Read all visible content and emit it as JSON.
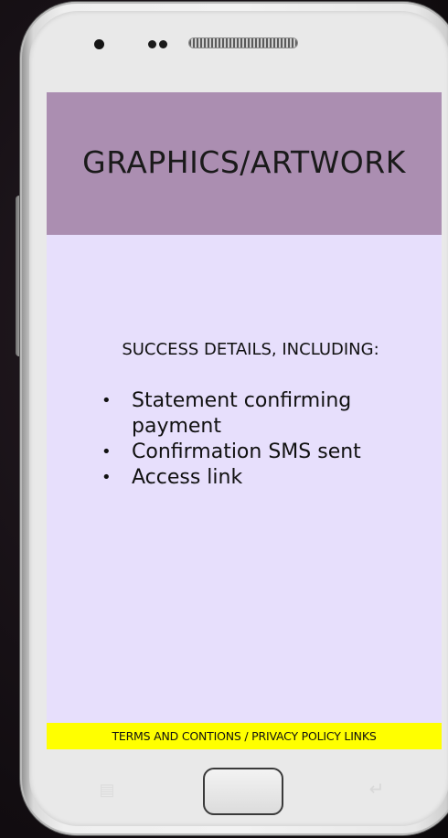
{
  "screen": {
    "header": {
      "title": "GRAPHICS/ARTWORK",
      "background_color": "#ab8eb1"
    },
    "body": {
      "background_color": "#e7dffc",
      "heading": "SUCCESS DETAILS, INCLUDING:",
      "items": [
        "Statement confirming payment",
        "Confirmation SMS sent",
        "Access link"
      ]
    },
    "footer": {
      "label": "TERMS AND CONTIONS / PRIVACY POLICY LINKS",
      "background_color": "#ffff00"
    }
  },
  "device": {
    "icons": [
      "camera-icon",
      "sensor-icon",
      "speaker-grille",
      "menu-key-icon",
      "home-button",
      "back-key-icon"
    ],
    "bullet": "•"
  }
}
